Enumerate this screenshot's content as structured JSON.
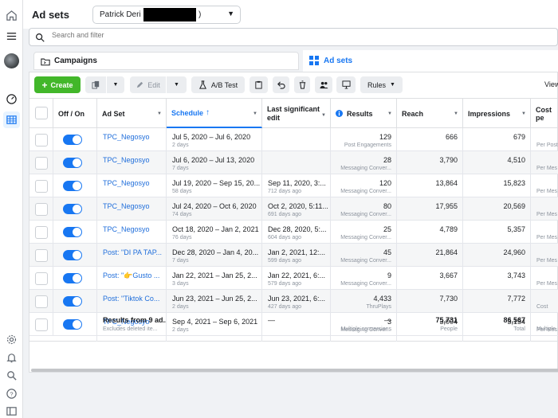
{
  "header": {
    "title": "Ad sets",
    "account_name": "Patrick Deri (2",
    "account_suffix": ")"
  },
  "search": {
    "placeholder": "Search and filter"
  },
  "tabs": {
    "campaigns": "Campaigns",
    "adsets": "Ad sets"
  },
  "toolbar": {
    "create": "Create",
    "edit": "Edit",
    "ab_test": "A/B Test",
    "rules": "Rules",
    "view": "View"
  },
  "columns": {
    "off_on": "Off / On",
    "ad_set": "Ad Set",
    "schedule": "Schedule",
    "last_edit": "Last significant edit",
    "results": "Results",
    "reach": "Reach",
    "impressions": "Impressions",
    "cost": "Cost pe"
  },
  "rows": [
    {
      "name": "TPC_Negosyo",
      "schedule": "Jul 5, 2020 – Jul 6, 2020",
      "duration": "2 days",
      "edit": "",
      "edit_ago": "",
      "results": "129",
      "result_type": "Post Engagements",
      "reach": "666",
      "impressions": "679",
      "cost_sub": "Per Post"
    },
    {
      "name": "TPC_Negosyo",
      "schedule": "Jul 6, 2020 – Jul 13, 2020",
      "duration": "7 days",
      "edit": "",
      "edit_ago": "",
      "results": "28",
      "result_type": "Messaging Conver...",
      "reach": "3,790",
      "impressions": "4,510",
      "cost_sub": "Per Mes"
    },
    {
      "name": "TPC_Negosyo",
      "schedule": "Jul 19, 2020 – Sep 15, 20...",
      "duration": "58 days",
      "edit": "Sep 11, 2020, 3:...",
      "edit_ago": "712 days ago",
      "results": "120",
      "result_type": "Messaging Conver...",
      "reach": "13,864",
      "impressions": "15,823",
      "cost_sub": "Per Mes"
    },
    {
      "name": "TPC_Negosyo",
      "schedule": "Jul 24, 2020 – Oct 6, 2020",
      "duration": "74 days",
      "edit": "Oct 2, 2020, 5:11...",
      "edit_ago": "691 days ago",
      "results": "80",
      "result_type": "Messaging Conver...",
      "reach": "17,955",
      "impressions": "20,569",
      "cost_sub": "Per Mes"
    },
    {
      "name": "TPC_Negosyo",
      "schedule": "Oct 18, 2020 – Jan 2, 2021",
      "duration": "76 days",
      "edit": "Dec 28, 2020, 5:...",
      "edit_ago": "604 days ago",
      "results": "25",
      "result_type": "Messaging Conver...",
      "reach": "4,789",
      "impressions": "5,357",
      "cost_sub": "Per Mes"
    },
    {
      "name": "Post: \"DI PA TAP...",
      "schedule": "Dec 28, 2020 – Jan 4, 20...",
      "duration": "7 days",
      "edit": "Jan 2, 2021, 12:...",
      "edit_ago": "599 days ago",
      "results": "45",
      "result_type": "Messaging Conver...",
      "reach": "21,864",
      "impressions": "24,960",
      "cost_sub": "Per Mes"
    },
    {
      "name": "Post: \"👉Gusto ...",
      "schedule": "Jan 22, 2021 – Jan 25, 2...",
      "duration": "3 days",
      "edit": "Jan 22, 2021, 6:...",
      "edit_ago": "579 days ago",
      "results": "9",
      "result_type": "Messaging Conver...",
      "reach": "3,667",
      "impressions": "3,743",
      "cost_sub": "Per Mes"
    },
    {
      "name": "Post: \"Tiktok Co...",
      "schedule": "Jun 23, 2021 – Jun 25, 2...",
      "duration": "2 days",
      "edit": "Jun 23, 2021, 6:...",
      "edit_ago": "427 days ago",
      "results": "4,433",
      "result_type": "ThruPlays",
      "reach": "7,730",
      "impressions": "7,772",
      "cost_sub": "Cost"
    },
    {
      "name": "TPC_Negosyo",
      "schedule": "Sep 4, 2021 – Sep 6, 2021",
      "duration": "2 days",
      "edit": "",
      "edit_ago": "",
      "results": "3",
      "result_type": "Messaging Conver...",
      "reach": "3,004",
      "impressions": "3,154",
      "cost_sub": "Per Mes"
    }
  ],
  "summary": {
    "label": "Results from 9 ad...",
    "note": "Excludes deleted ite...",
    "edit": "—",
    "results": "—",
    "results_sub": "Multiple conversions",
    "reach": "75,731",
    "reach_sub": "People",
    "impressions": "86,567",
    "impressions_sub": "Total",
    "cost_sub": "Multiple"
  },
  "colors": {
    "accent": "#1877f2",
    "create_green": "#42b72a"
  }
}
